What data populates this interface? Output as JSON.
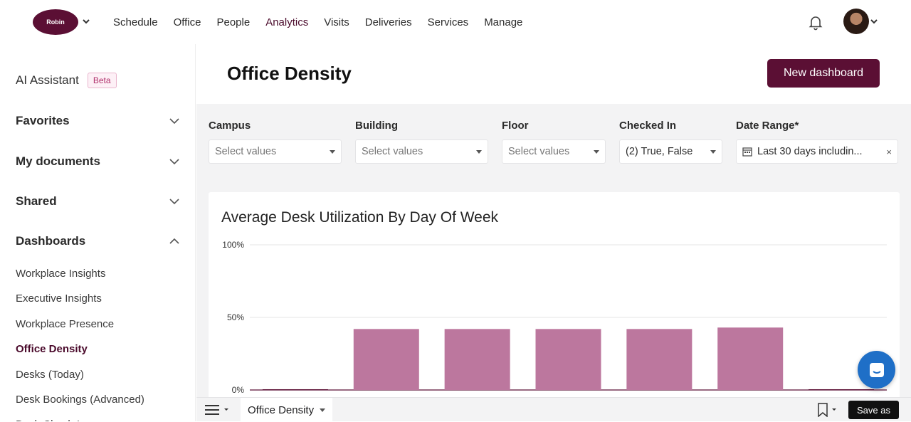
{
  "brand": {
    "logo_text": "Robin",
    "primary_color": "#5b0f34"
  },
  "nav": {
    "items": [
      {
        "label": "Schedule"
      },
      {
        "label": "Office"
      },
      {
        "label": "People"
      },
      {
        "label": "Analytics"
      },
      {
        "label": "Visits"
      },
      {
        "label": "Deliveries"
      },
      {
        "label": "Services"
      },
      {
        "label": "Manage"
      }
    ],
    "active": "Analytics"
  },
  "sidebar": {
    "ai_label": "AI Assistant",
    "ai_badge": "Beta",
    "sections": [
      {
        "label": "Favorites",
        "expanded": false
      },
      {
        "label": "My documents",
        "expanded": false
      },
      {
        "label": "Shared",
        "expanded": false
      },
      {
        "label": "Dashboards",
        "expanded": true
      }
    ],
    "dashboards": [
      {
        "label": "Workplace Insights"
      },
      {
        "label": "Executive Insights"
      },
      {
        "label": "Workplace Presence"
      },
      {
        "label": "Office Density"
      },
      {
        "label": "Desks (Today)"
      },
      {
        "label": "Desk Bookings (Advanced)"
      },
      {
        "label": "Desk Check-Ins"
      }
    ],
    "active_dashboard": "Office Density"
  },
  "header": {
    "title": "Office Density",
    "new_button": "New dashboard"
  },
  "filters": [
    {
      "label": "Campus",
      "value": "",
      "placeholder": "Select values"
    },
    {
      "label": "Building",
      "value": "",
      "placeholder": "Select values"
    },
    {
      "label": "Floor",
      "value": "",
      "placeholder": "Select values"
    },
    {
      "label": "Checked In",
      "value": "(2) True, False",
      "placeholder": ""
    },
    {
      "label": "Date Range*",
      "value": "Last 30 days includin...",
      "placeholder": ""
    }
  ],
  "chart_card": {
    "title": "Average Desk Utilization By Day Of Week"
  },
  "chart_data": {
    "type": "bar",
    "categories": [
      "",
      "",
      "",
      "",
      "",
      "",
      ""
    ],
    "values": [
      0.5,
      42,
      42,
      42,
      42,
      43,
      0.5
    ],
    "title": "Average Desk Utilization By Day Of Week",
    "xlabel": "",
    "ylabel": "",
    "ylim": [
      0,
      100
    ],
    "yticks": [
      "0%",
      "50%",
      "100%"
    ],
    "grid": true,
    "bar_color": "#bc779e",
    "baseline_color": "#5b0f34"
  },
  "bottom": {
    "tab_label": "Office Density",
    "save_label": "Save as"
  }
}
